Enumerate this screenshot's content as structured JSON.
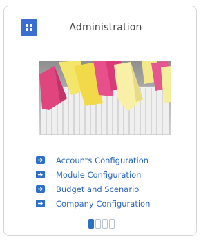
{
  "widget": {
    "title": "Administration",
    "header_icon": "grid-icon",
    "image_alt": "file folder tabs"
  },
  "links": [
    {
      "label": "Accounts Configuration",
      "icon": "arrow-right-icon"
    },
    {
      "label": "Module Configuration",
      "icon": "arrow-right-icon"
    },
    {
      "label": "Budget and Scenario",
      "icon": "arrow-right-icon"
    },
    {
      "label": "Company Configuration",
      "icon": "arrow-right-icon"
    }
  ],
  "pager": {
    "pages": 4,
    "active": 1
  },
  "colors": {
    "accent": "#2b6fc7",
    "link": "#2a66b8",
    "title": "#444444",
    "border": "#d4d4d4"
  }
}
